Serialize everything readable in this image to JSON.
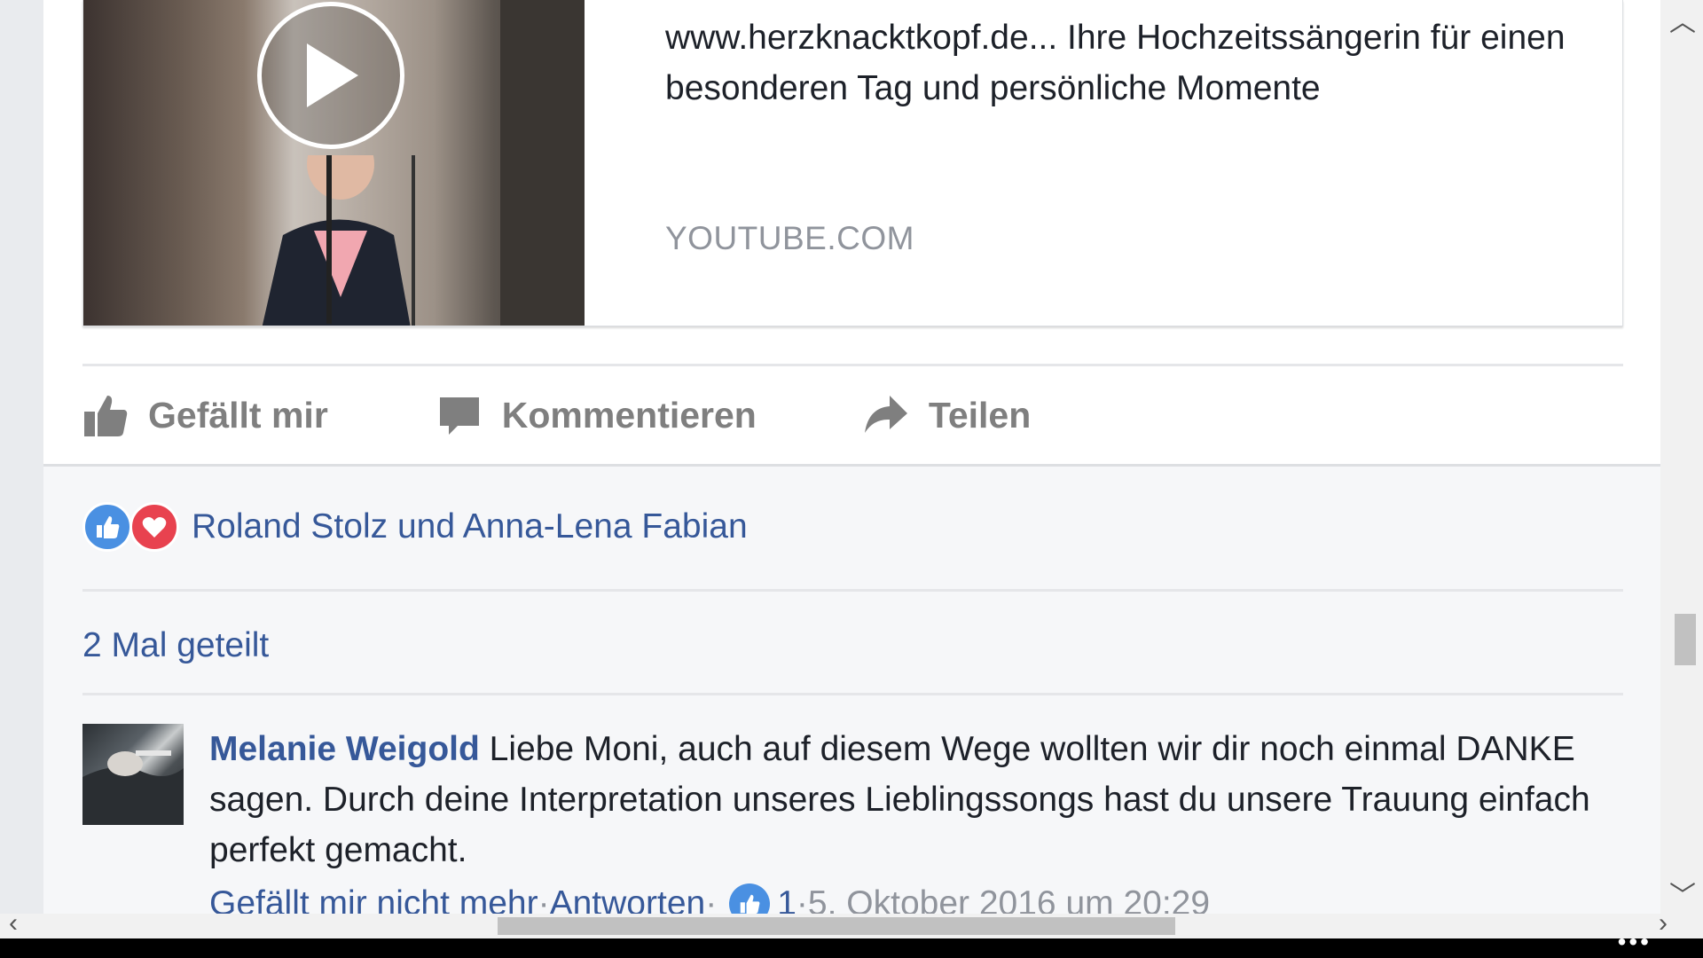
{
  "link_preview": {
    "title": "www.herzknacktkopf.de... Ihre Hochzeitssängerin für einen besonderen Tag und persönliche Momente",
    "domain": "YOUTUBE.COM"
  },
  "actions": {
    "like_label": "Gefällt mir",
    "comment_label": "Kommentieren",
    "share_label": "Teilen"
  },
  "reactions": {
    "names": "Roland Stolz und Anna-Lena Fabian"
  },
  "shares": {
    "text": "2 Mal geteilt"
  },
  "comment": {
    "author": "Melanie Weigold",
    "text": " Liebe Moni, auch auf diesem Wege wollten wir dir noch einmal DANKE sagen. Durch deine Interpretation unseres Lieblingssongs hast du unsere Trauung einfach perfekt gemacht.",
    "unlike_label": "Gefällt mir nicht mehr",
    "reply_label": "Antworten",
    "separator": " · ",
    "like_count": "1",
    "timestamp": "5. Oktober 2016 um 20:29"
  },
  "colors": {
    "link_blue": "#365899",
    "like_blue": "#4a90e2",
    "love_red": "#e8424f",
    "action_gray": "#7f7f7f"
  },
  "icons": [
    "play-icon",
    "thumbs-up-icon",
    "comment-bubble-icon",
    "share-arrow-icon",
    "like-reaction-icon",
    "love-reaction-icon"
  ]
}
